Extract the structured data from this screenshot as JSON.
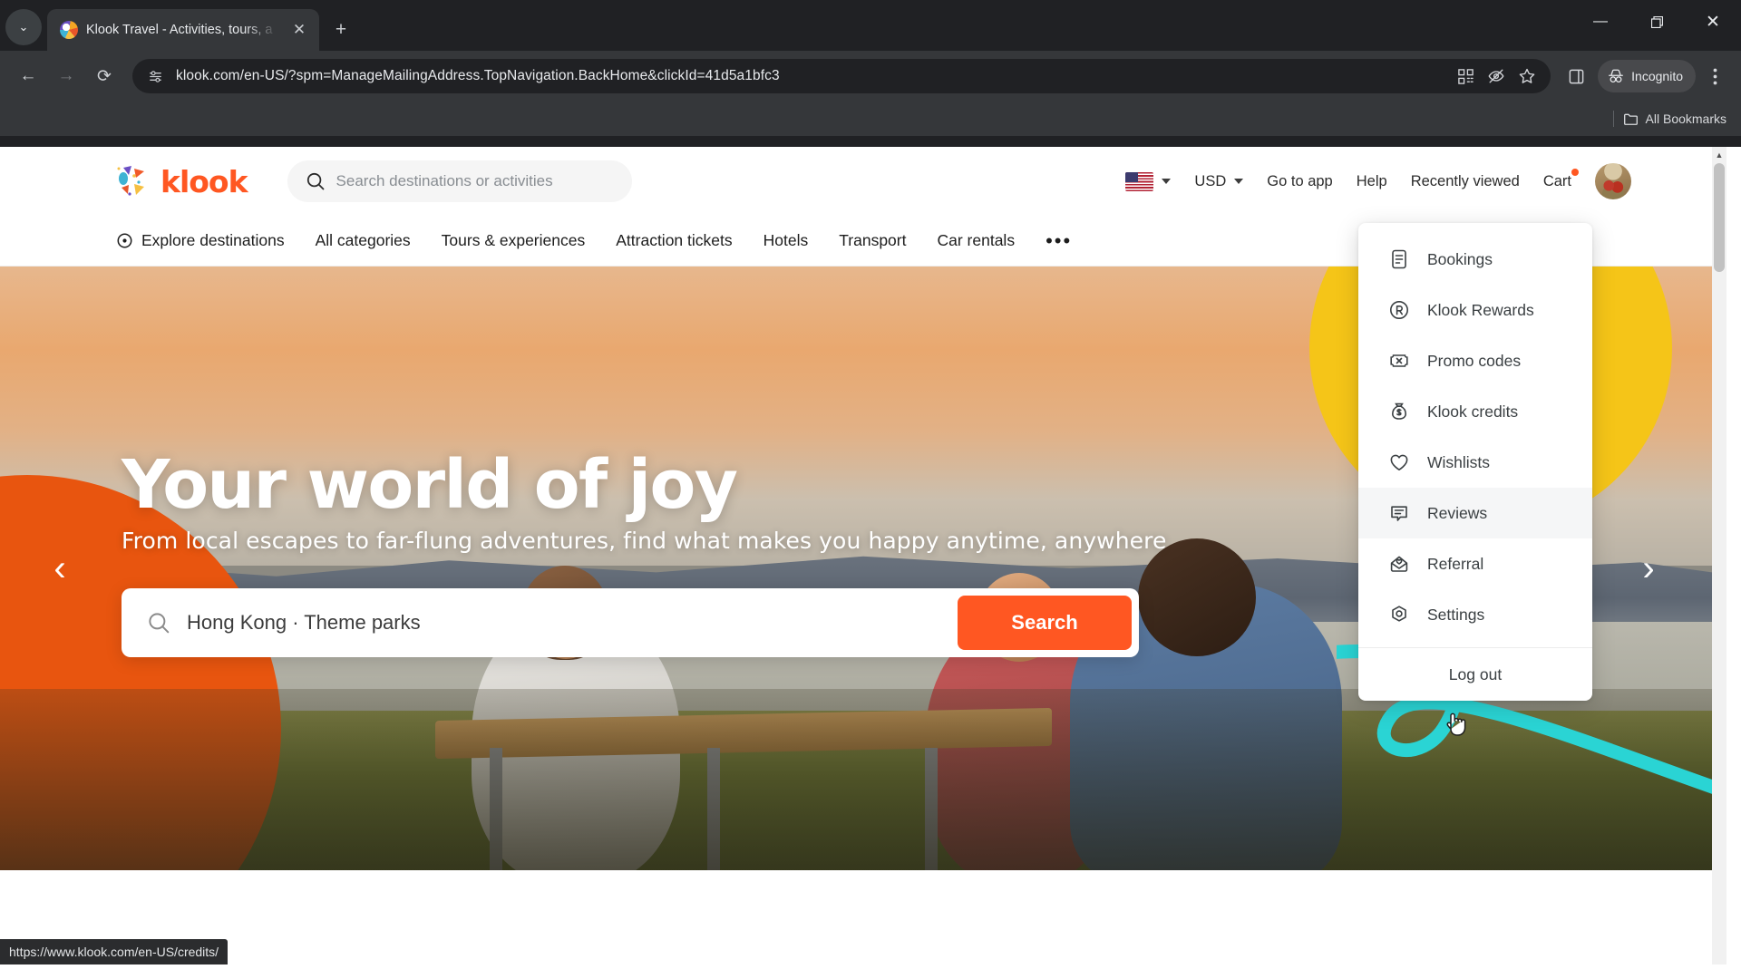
{
  "browser": {
    "tab": {
      "title": "Klook Travel - Activities, tours, a",
      "favicon": "klook-favicon",
      "close_label": "✕"
    },
    "new_tab_label": "+",
    "tab_list_label": "⌄",
    "window": {
      "minimize": "—",
      "maximize": "❐",
      "close": "✕"
    },
    "nav": {
      "back": "←",
      "forward": "→",
      "reload": "⟳"
    },
    "omnibox": {
      "url": "klook.com/en-US/?spm=ManageMailingAddress.TopNavigation.BackHome&clickId=41d5a1bfc3",
      "site_info_icon": "site-settings-icon",
      "qr_icon": "qr-code-icon",
      "tracking_icon": "tracking-protection-off-icon",
      "bookmark_icon": "star-icon"
    },
    "side_panel_icon": "side-panel-icon",
    "incognito_label": "Incognito",
    "menu_icon": "kebab-menu-icon",
    "bookmarks_bar": {
      "all_bookmarks_label": "All Bookmarks",
      "folder_icon": "folder-icon"
    },
    "status_bar_url": "https://www.klook.com/en-US/credits/"
  },
  "site": {
    "brand": "klook",
    "header": {
      "search_placeholder": "Search destinations or activities",
      "search_icon": "search-icon",
      "locale": {
        "flag": "us-flag",
        "caret": "chevron-down-icon"
      },
      "currency": "USD",
      "links": [
        "Go to app",
        "Help",
        "Recently viewed",
        "Cart"
      ],
      "avatar": "user-avatar"
    },
    "nav": {
      "explore": "Explore destinations",
      "explore_icon": "location-pin-icon",
      "items": [
        "All categories",
        "Tours & experiences",
        "Attraction tickets",
        "Hotels",
        "Transport",
        "Car rentals"
      ],
      "more": "•••"
    },
    "hero": {
      "title": "Your world of joy",
      "subtitle": "From local escapes to far-flung adventures, find what makes you happy anytime, anywhere",
      "search_value": "Hong Kong · Theme parks",
      "search_icon": "search-icon",
      "search_button": "Search",
      "prev_arrow": "‹",
      "next_arrow": "›"
    },
    "account_menu": {
      "items": [
        {
          "label": "Bookings",
          "icon": "document-list-icon",
          "hovered": false
        },
        {
          "label": "Klook Rewards",
          "icon": "rewards-badge-icon",
          "hovered": false
        },
        {
          "label": "Promo codes",
          "icon": "coupon-icon",
          "hovered": false
        },
        {
          "label": "Klook credits",
          "icon": "money-bag-icon",
          "hovered": false
        },
        {
          "label": "Wishlists",
          "icon": "heart-icon",
          "hovered": false
        },
        {
          "label": "Reviews",
          "icon": "comment-lines-icon",
          "hovered": true
        },
        {
          "label": "Referral",
          "icon": "envelope-heart-icon",
          "hovered": false
        },
        {
          "label": "Settings",
          "icon": "gear-hex-icon",
          "hovered": false
        }
      ],
      "logout_label": "Log out"
    },
    "colors": {
      "brand_orange": "#ff5722",
      "hero_blob_orange": "#e8550f",
      "hero_blob_yellow": "#f5c518",
      "accent_teal": "#2ad4d4"
    }
  }
}
